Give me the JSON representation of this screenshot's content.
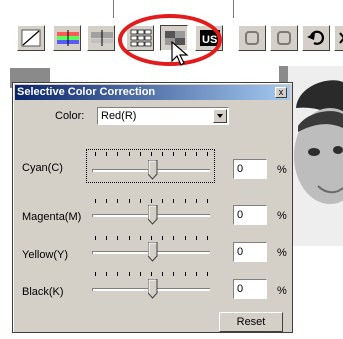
{
  "dialog": {
    "title": "Selective Color Correction",
    "close_label": "x",
    "color_label": "Color:",
    "color_value": "Red(R)",
    "reset_label": "Reset"
  },
  "sliders": [
    {
      "label": "Cyan(C)",
      "value": "0",
      "unit": "%"
    },
    {
      "label": "Magenta(M)",
      "value": "0",
      "unit": "%"
    },
    {
      "label": "Yellow(Y)",
      "value": "0",
      "unit": "%"
    },
    {
      "label": "Black(K)",
      "value": "0",
      "unit": "%"
    }
  ],
  "toolbar_icons": [
    "tone-curve-icon",
    "color-balance-icon",
    "hue-saturation-icon",
    "variations-icon",
    "selective-color-icon",
    "unsharp-mask-icon",
    "rotate-left-icon",
    "rotate-right-icon",
    "undo-icon",
    "redo-icon"
  ],
  "accent": {
    "highlight": "#e21b1b",
    "title_start": "#0a246a",
    "title_end": "#a6caf0"
  }
}
